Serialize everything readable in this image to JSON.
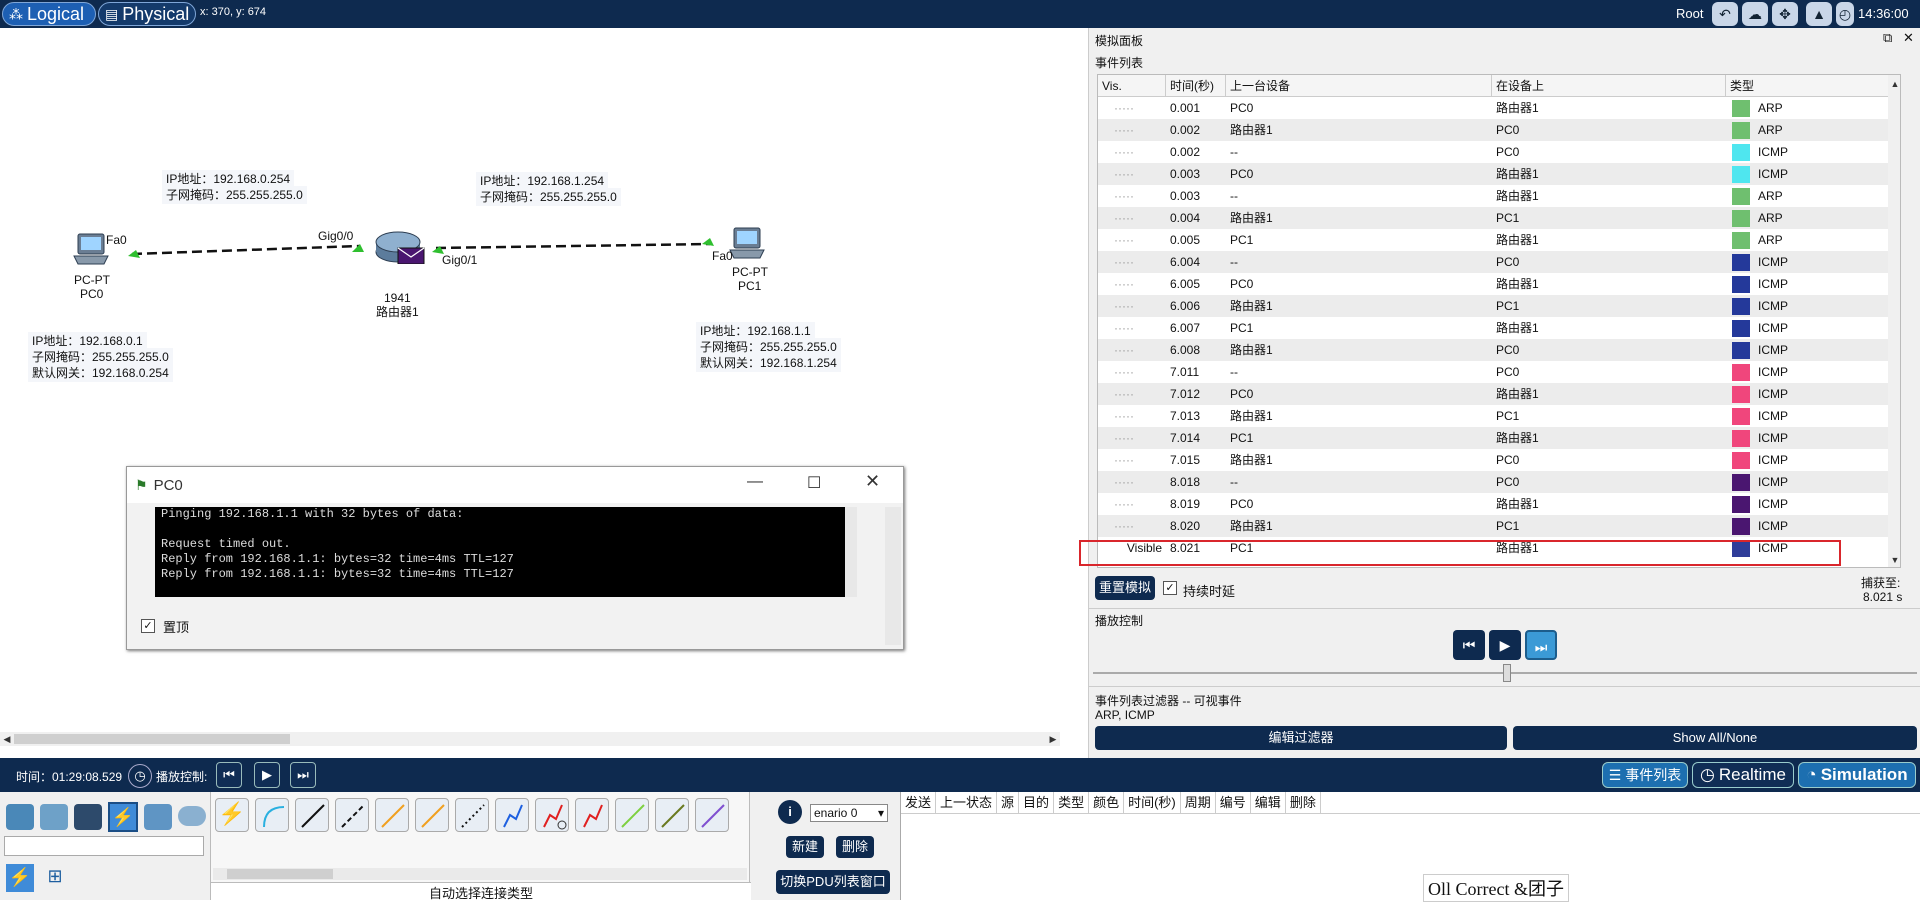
{
  "topbar": {
    "logical_label": "Logical",
    "physical_label": "Physical",
    "coords": "x: 370, y: 674",
    "root_label": "Root",
    "clock": "14:36:00"
  },
  "topology": {
    "pc0": {
      "type": "PC-PT",
      "name": "PC0",
      "port": "Fa0",
      "ip": "IP地址：192.168.0.1",
      "mask": "子网掩码：255.255.255.0",
      "gw": "默认网关：192.168.0.254"
    },
    "pc1": {
      "type": "PC-PT",
      "name": "PC1",
      "port": "Fa0",
      "ip": "IP地址：192.168.1.1",
      "mask": "子网掩码：255.255.255.0",
      "gw": "默认网关：192.168.1.254"
    },
    "router": {
      "model": "1941",
      "name": "路由器1",
      "port_left": "Gig0/0",
      "port_right": "Gig0/1"
    },
    "if_left": {
      "ip": "IP地址：192.168.0.254",
      "mask": "子网掩码：255.255.255.0"
    },
    "if_right": {
      "ip": "IP地址：192.168.1.254",
      "mask": "子网掩码：255.255.255.0"
    }
  },
  "terminal": {
    "title": "PC0",
    "lines": [
      "Pinging 192.168.1.1 with 32 bytes of data:",
      "",
      "Request timed out.",
      "Reply from 192.168.1.1: bytes=32 time=4ms TTL=127",
      "Reply from 192.168.1.1: bytes=32 time=4ms TTL=127"
    ],
    "ontop_label": "置顶"
  },
  "sim_panel": {
    "title": "模拟面板",
    "event_list_label": "事件列表",
    "columns": [
      "Vis.",
      "时间(秒)",
      "上一台设备",
      "在设备上",
      "类型"
    ],
    "events": [
      {
        "vis": "",
        "time": "0.001",
        "last": "PC0",
        "at": "路由器1",
        "color": "#6fbf6f",
        "type": "ARP"
      },
      {
        "vis": "",
        "time": "0.002",
        "last": "路由器1",
        "at": "PC0",
        "color": "#6fbf6f",
        "type": "ARP"
      },
      {
        "vis": "",
        "time": "0.002",
        "last": "--",
        "at": "PC0",
        "color": "#4fe6ef",
        "type": "ICMP"
      },
      {
        "vis": "",
        "time": "0.003",
        "last": "PC0",
        "at": "路由器1",
        "color": "#4fe6ef",
        "type": "ICMP"
      },
      {
        "vis": "",
        "time": "0.003",
        "last": "--",
        "at": "路由器1",
        "color": "#6fbf6f",
        "type": "ARP"
      },
      {
        "vis": "",
        "time": "0.004",
        "last": "路由器1",
        "at": "PC1",
        "color": "#6fbf6f",
        "type": "ARP"
      },
      {
        "vis": "",
        "time": "0.005",
        "last": "PC1",
        "at": "路由器1",
        "color": "#6fbf6f",
        "type": "ARP"
      },
      {
        "vis": "",
        "time": "6.004",
        "last": "--",
        "at": "PC0",
        "color": "#24399a",
        "type": "ICMP"
      },
      {
        "vis": "",
        "time": "6.005",
        "last": "PC0",
        "at": "路由器1",
        "color": "#24399a",
        "type": "ICMP"
      },
      {
        "vis": "",
        "time": "6.006",
        "last": "路由器1",
        "at": "PC1",
        "color": "#24399a",
        "type": "ICMP"
      },
      {
        "vis": "",
        "time": "6.007",
        "last": "PC1",
        "at": "路由器1",
        "color": "#24399a",
        "type": "ICMP"
      },
      {
        "vis": "",
        "time": "6.008",
        "last": "路由器1",
        "at": "PC0",
        "color": "#24399a",
        "type": "ICMP"
      },
      {
        "vis": "",
        "time": "7.011",
        "last": "--",
        "at": "PC0",
        "color": "#f0467c",
        "type": "ICMP"
      },
      {
        "vis": "",
        "time": "7.012",
        "last": "PC0",
        "at": "路由器1",
        "color": "#f0467c",
        "type": "ICMP"
      },
      {
        "vis": "",
        "time": "7.013",
        "last": "路由器1",
        "at": "PC1",
        "color": "#f0467c",
        "type": "ICMP"
      },
      {
        "vis": "",
        "time": "7.014",
        "last": "PC1",
        "at": "路由器1",
        "color": "#f0467c",
        "type": "ICMP"
      },
      {
        "vis": "",
        "time": "7.015",
        "last": "路由器1",
        "at": "PC0",
        "color": "#f0467c",
        "type": "ICMP"
      },
      {
        "vis": "",
        "time": "8.018",
        "last": "--",
        "at": "PC0",
        "color": "#4a1670",
        "type": "ICMP"
      },
      {
        "vis": "",
        "time": "8.019",
        "last": "PC0",
        "at": "路由器1",
        "color": "#4a1670",
        "type": "ICMP"
      },
      {
        "vis": "",
        "time": "8.020",
        "last": "路由器1",
        "at": "PC1",
        "color": "#4a1670",
        "type": "ICMP"
      },
      {
        "vis": "Visible",
        "time": "8.021",
        "last": "PC1",
        "at": "路由器1",
        "color": "#2f3d99",
        "type": "ICMP"
      }
    ],
    "reset_label": "重置模拟",
    "constant_delay_label": "持续时延",
    "captured_label": "捕获至:",
    "captured_value": "8.021 s",
    "play_control_label": "播放控制",
    "filter_label": "事件列表过滤器 -- 可视事件",
    "filter_value": "ARP, ICMP",
    "edit_filter_label": "编辑过滤器",
    "show_all_label": "Show All/None"
  },
  "bottombar": {
    "time": "时间：01:29:08.529",
    "play_label": "播放控制:",
    "event_list_tab": "事件列表",
    "realtime_tab": "Realtime",
    "simulation_tab": "Simulation"
  },
  "bottom": {
    "auto_conn_label": "自动选择连接类型",
    "scenario": "enario 0",
    "new_label": "新建",
    "delete_label": "删除",
    "toggle_pdu_label": "切换PDU列表窗口",
    "pdu_columns": [
      "发送",
      "上一状态",
      "源",
      "目的",
      "类型",
      "颜色",
      "时间(秒)",
      "周期",
      "编号",
      "编辑",
      "删除"
    ],
    "watermark": "Oll Correct &团子"
  },
  "colors": {
    "navy": "#0e2a4f",
    "highlight": "#d9262c"
  }
}
